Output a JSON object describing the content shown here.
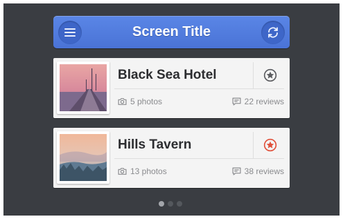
{
  "header": {
    "title": "Screen Title",
    "menu_icon": "menu-icon",
    "refresh_icon": "refresh-icon",
    "color": "#4a73d6"
  },
  "items": [
    {
      "name": "Black Sea Hotel",
      "photos": "5 photos",
      "reviews": "22 reviews",
      "favorite": false,
      "star_color": "#5b5c60"
    },
    {
      "name": "Hills Tavern",
      "photos": "13 photos",
      "reviews": "38 reviews",
      "favorite": true,
      "star_color": "#e0513c"
    }
  ],
  "pager": {
    "pages": 3,
    "active": 1
  },
  "colors": {
    "background": "#3a3d42",
    "card": "#f4f4f4",
    "accent": "#4a73d6",
    "favorite": "#e0513c"
  }
}
